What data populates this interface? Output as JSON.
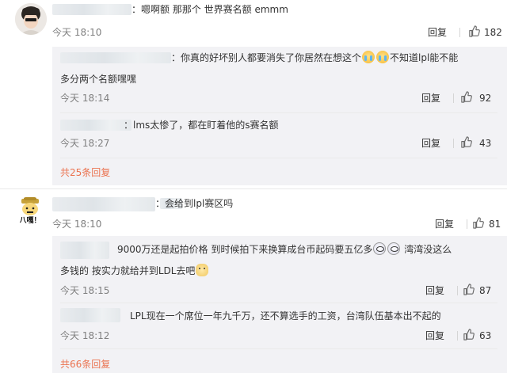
{
  "comments": [
    {
      "text": "：嗯啊额 那那个 世界赛名额 emmm",
      "time": "今天 18:10",
      "reply_label": "回复",
      "likes": "182",
      "replies": [
        {
          "text_a": "：你真的好坏别人都要消失了你居然在想这个",
          "text_b": "不知道lpl能不能",
          "text_c": "多分两个名额嘿嘿",
          "time": "今天 18:14",
          "reply_label": "回复",
          "likes": "92"
        },
        {
          "text": "：lms太惨了，都在盯着他的s赛名额",
          "time": "今天 18:27",
          "reply_label": "回复",
          "likes": "43"
        }
      ],
      "more_replies": "共25条回复"
    },
    {
      "avatar_text": "八嘎！",
      "text": "：会给到lpl赛区吗",
      "time": "今天 18:10",
      "reply_label": "回复",
      "likes": "81",
      "replies": [
        {
          "text_a": "9000万还是起拍价格 到时候拍下来换算成台币起码要五亿多",
          "text_b": "湾湾没这么",
          "text_c": "多钱的 按实力就给并到LDL去吧",
          "time": "今天 18:15",
          "reply_label": "回复",
          "likes": "87"
        },
        {
          "text": "LPL现在一个席位一年九千万，还不算选手的工资，台湾队伍基本出不起的",
          "time": "今天 18:12",
          "reply_label": "回复",
          "likes": "63"
        }
      ],
      "more_replies": "共66条回复"
    }
  ],
  "icons": {
    "like": "thumbs-up-icon",
    "emoji_cry": "crying-face-emoji",
    "emoji_dizzy": "dizzy-face-emoji",
    "emoji_dog": "dog-face-emoji"
  },
  "colors": {
    "link": "#eb7350",
    "reply_bg": "#f2f2f5",
    "time": "#808080"
  }
}
